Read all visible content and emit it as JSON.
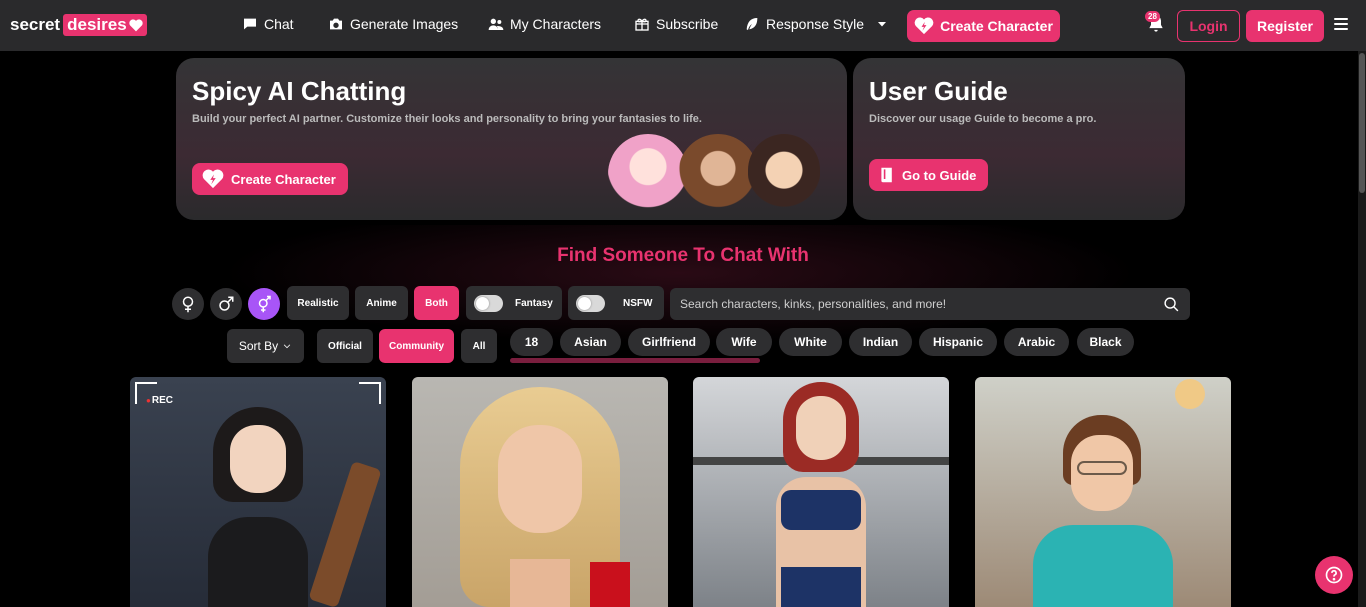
{
  "nav": {
    "logo_word1": "secret",
    "logo_word2": "desires",
    "items": [
      {
        "label": "Chat",
        "icon": "chat-icon"
      },
      {
        "label": "Generate Images",
        "icon": "camera-icon"
      },
      {
        "label": "My Characters",
        "icon": "users-icon"
      },
      {
        "label": "Subscribe",
        "icon": "gift-icon"
      },
      {
        "label": "Response Style",
        "icon": "feather-icon"
      }
    ],
    "create_label": "Create Character",
    "notification_count": "28",
    "login_label": "Login",
    "register_label": "Register"
  },
  "hero": {
    "left": {
      "title": "Spicy AI Chatting",
      "subtitle": "Build your perfect AI partner. Customize their looks and personality to bring your fantasies to life.",
      "button": "Create Character"
    },
    "right": {
      "title": "User Guide",
      "subtitle": "Discover our usage Guide to become a pro.",
      "button": "Go to Guide"
    }
  },
  "section_title": "Find Someone To Chat With",
  "filters": {
    "style": [
      "Realistic",
      "Anime",
      "Both"
    ],
    "style_active": "Both",
    "fantasy_label": "Fantasy",
    "nsfw_label": "NSFW",
    "search_placeholder": "Search characters, kinks, personalities, and more!",
    "sort_label": "Sort By",
    "source": [
      "Official",
      "Community",
      "All"
    ],
    "source_active": "Community",
    "tags": [
      "18",
      "Asian",
      "Girlfriend",
      "Wife",
      "White",
      "Indian",
      "Hispanic",
      "Arabic",
      "Black"
    ]
  },
  "cards": [
    {
      "badge": "REC"
    },
    {},
    {},
    {}
  ],
  "colors": {
    "accent": "#e8336f",
    "gender_active": "#a855f7",
    "nav_bg": "#2a2a2c"
  }
}
